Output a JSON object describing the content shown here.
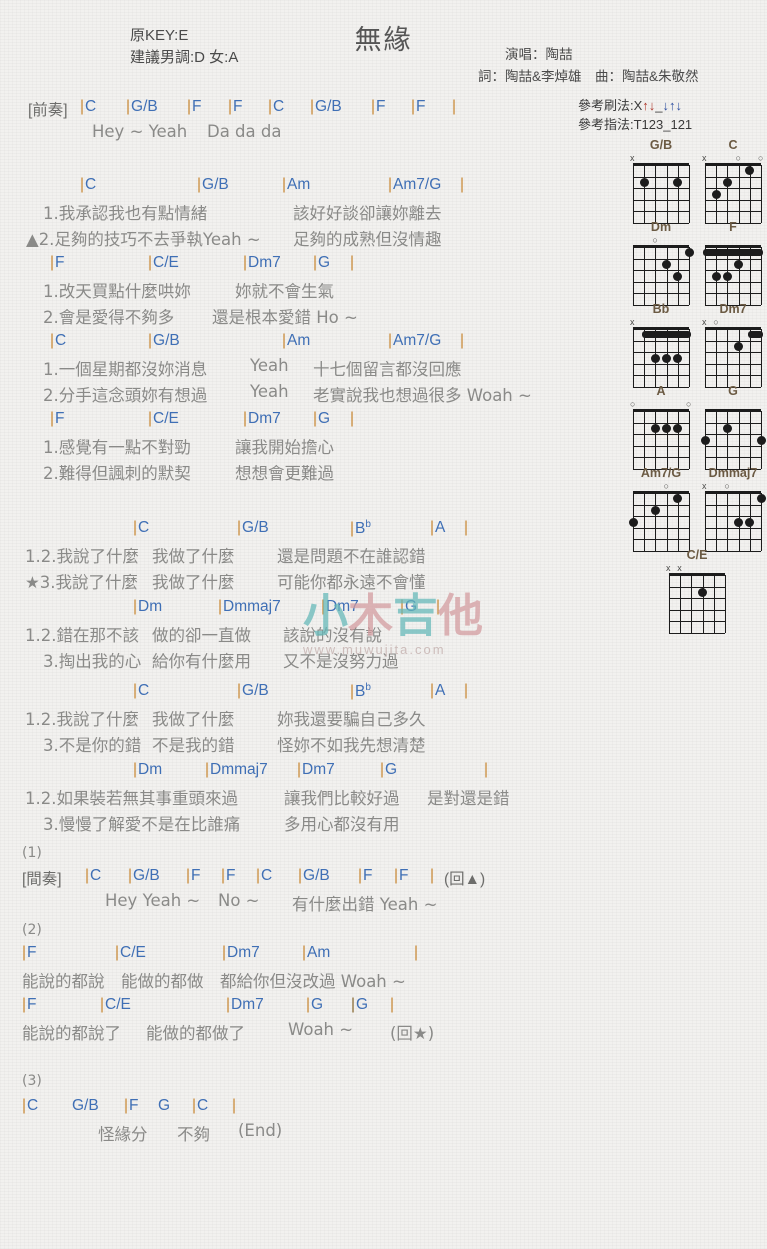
{
  "header": {
    "orig_key": "原KEY:E",
    "suggest_key": "建議男調:D 女:A",
    "title": "無緣",
    "singer": "演唱：陶喆",
    "writers": "詞：陶喆&李焯雄　曲：陶喆&朱敬然",
    "strum_label": "參考刷法:X",
    "strum_pattern_1": "↑↓",
    "strum_pattern_sep": "_",
    "strum_pattern_2": "↓↑↓",
    "fingerstyle": "參考指法:T123_121"
  },
  "sections": [
    {
      "name": "intro",
      "label": "[前奏]",
      "chords": [
        "C",
        "G/B",
        "F",
        "F",
        "C",
        "G/B",
        "F",
        "F"
      ],
      "lyrics": [
        "Hey ~ Yeah",
        "Da da da"
      ]
    },
    {
      "name": "verse1a",
      "chords": [
        "C",
        "G/B",
        "Am",
        "Am7/G"
      ],
      "line1": "1.我承認我也有點情緒",
      "line1b": "該好好談卻讓妳離去",
      "line2": "▲2.足夠的技巧不去爭執Yeah ~",
      "line2b": "足夠的成熟但沒情趣"
    },
    {
      "name": "verse1b",
      "chords": [
        "F",
        "C/E",
        "Dm7",
        "G"
      ],
      "line1": "1.改天買點什麼哄妳",
      "line1b": "妳就不會生氣",
      "line2": "2.會是愛得不夠多",
      "line2b": "還是根本愛錯 Ho ~"
    },
    {
      "name": "verse2a",
      "chords": [
        "C",
        "G/B",
        "Am",
        "Am7/G"
      ],
      "line1": "1.一個星期都沒妳消息",
      "line1mid": "Yeah",
      "line1b": "十七個留言都沒回應",
      "line2": "2.分手這念頭妳有想過",
      "line2mid": "Yeah",
      "line2b": "老實說我也想過很多 Woah ~"
    },
    {
      "name": "verse2b",
      "chords": [
        "F",
        "C/E",
        "Dm7",
        "G"
      ],
      "line1": "1.感覺有一點不對勁",
      "line1b": "讓我開始擔心",
      "line2": "2.難得但諷刺的默契",
      "line2b": "想想會更難過"
    },
    {
      "name": "chorus1a",
      "chords": [
        "C",
        "G/B",
        "Bb",
        "A"
      ],
      "line1": "1.2.我說了什麼",
      "line1m": "我做了什麼",
      "line1b": "還是問題不在誰認錯",
      "line2": "★3.我說了什麼",
      "line2m": "我做了什麼",
      "line2b": "可能你都永遠不會懂"
    },
    {
      "name": "chorus1b",
      "chords": [
        "Dm",
        "Dmmaj7",
        "Dm7",
        "G"
      ],
      "line1": "1.2.錯在那不該",
      "line1m": "做的卻一直做",
      "line1b": "該說的沒有說",
      "line2": "3.掏出我的心",
      "line2m": "給你有什麼用",
      "line2b": "又不是沒努力過"
    },
    {
      "name": "chorus2a",
      "chords": [
        "C",
        "G/B",
        "Bb",
        "A"
      ],
      "line1": "1.2.我說了什麼",
      "line1m": "我做了什麼",
      "line1b": "妳我還要騙自己多久",
      "line2": "3.不是你的錯",
      "line2m": "不是我的錯",
      "line2b": "怪妳不如我先想清楚"
    },
    {
      "name": "chorus2b",
      "chords": [
        "Dm",
        "Dmmaj7",
        "Dm7",
        "G"
      ],
      "line1": "1.2.如果裝若無其事重頭來過",
      "line1m": "讓我們比較好過",
      "line1b": "是對還是錯",
      "line2": "3.慢慢了解愛不是在比誰痛",
      "line2m": "多用心都沒有用"
    },
    {
      "name": "interlude",
      "num": "(1)",
      "label": "[間奏]",
      "chords": [
        "C",
        "G/B",
        "F",
        "F",
        "C",
        "G/B",
        "F",
        "F"
      ],
      "repeat": "(回▲)",
      "lyric1": "Hey Yeah ~",
      "lyric2": "No ~",
      "lyric3": "有什麼出錯 Yeah ~"
    },
    {
      "name": "bridge",
      "num": "(2)",
      "chords_a": [
        "F",
        "C/E",
        "Dm7",
        "Am"
      ],
      "lyric_a": "能說的都說　能做的都做　都給你但沒改過 Woah ~",
      "chords_b": [
        "F",
        "C/E",
        "Dm7",
        "G",
        "G"
      ],
      "lyric_b1": "能說的都說了",
      "lyric_b2": "能做的都做了",
      "lyric_b3": "Woah ~",
      "repeat": "(回★)"
    },
    {
      "name": "ending",
      "num": "(3)",
      "chords": [
        "C",
        "G/B",
        "F",
        "G",
        "C"
      ],
      "lyric1": "怪緣分",
      "lyric2": "不夠",
      "lyric3": "(End)"
    }
  ],
  "chord_diagrams": [
    {
      "name": "G/B",
      "marks": [
        {
          "s": 0,
          "t": "x"
        }
      ],
      "dots": [
        {
          "s": 1,
          "f": 2
        },
        {
          "s": 4,
          "f": 2
        }
      ],
      "barre": null
    },
    {
      "name": "C",
      "marks": [
        {
          "s": 0,
          "t": "x"
        },
        {
          "s": 3,
          "t": "o"
        },
        {
          "s": 5,
          "t": "o"
        }
      ],
      "dots": [
        {
          "s": 1,
          "f": 3
        },
        {
          "s": 2,
          "f": 2
        },
        {
          "s": 4,
          "f": 1
        }
      ],
      "barre": null
    },
    {
      "name": "Dm",
      "marks": [
        {
          "s": 2,
          "t": "o"
        }
      ],
      "dots": [
        {
          "s": 3,
          "f": 2
        },
        {
          "s": 4,
          "f": 3
        },
        {
          "s": 5,
          "f": 1
        }
      ],
      "barre": null
    },
    {
      "name": "F",
      "marks": [],
      "dots": [
        {
          "s": 1,
          "f": 3
        },
        {
          "s": 2,
          "f": 3
        },
        {
          "s": 3,
          "f": 2
        }
      ],
      "barre": {
        "f": 1,
        "from": 0,
        "to": 5
      }
    },
    {
      "name": "Bb",
      "marks": [
        {
          "s": 0,
          "t": "x"
        }
      ],
      "dots": [
        {
          "s": 2,
          "f": 3
        },
        {
          "s": 3,
          "f": 3
        },
        {
          "s": 4,
          "f": 3
        }
      ],
      "barre": {
        "f": 1,
        "from": 1,
        "to": 5
      }
    },
    {
      "name": "Dm7",
      "marks": [
        {
          "s": 0,
          "t": "x"
        },
        {
          "s": 1,
          "t": "o"
        }
      ],
      "dots": [
        {
          "s": 3,
          "f": 2
        }
      ],
      "barre": {
        "f": 1,
        "from": 4,
        "to": 5
      }
    },
    {
      "name": "A",
      "marks": [
        {
          "s": 0,
          "t": "o"
        },
        {
          "s": 5,
          "t": "o"
        }
      ],
      "dots": [
        {
          "s": 2,
          "f": 2
        },
        {
          "s": 3,
          "f": 2
        },
        {
          "s": 4,
          "f": 2
        }
      ],
      "barre": null
    },
    {
      "name": "G",
      "marks": [],
      "dots": [
        {
          "s": 0,
          "f": 3
        },
        {
          "s": 2,
          "f": 2
        },
        {
          "s": 5,
          "f": 3
        }
      ],
      "barre": null
    },
    {
      "name": "Am7/G",
      "marks": [
        {
          "s": 3,
          "t": "o"
        }
      ],
      "dots": [
        {
          "s": 0,
          "f": 3
        },
        {
          "s": 2,
          "f": 2
        },
        {
          "s": 4,
          "f": 1
        }
      ],
      "barre": null
    },
    {
      "name": "Dmmaj7",
      "marks": [
        {
          "s": 0,
          "t": "x"
        },
        {
          "s": 2,
          "t": "o"
        }
      ],
      "dots": [
        {
          "s": 3,
          "f": 3
        },
        {
          "s": 4,
          "f": 3
        },
        {
          "s": 5,
          "f": 1
        }
      ],
      "barre": null
    },
    {
      "name": "C/E",
      "marks": [
        {
          "s": 0,
          "t": "x"
        },
        {
          "s": 1,
          "t": "x"
        }
      ],
      "dots": [
        {
          "s": 3,
          "f": 2
        }
      ],
      "barre": null
    }
  ],
  "watermark": {
    "text_1": "小",
    "text_2": "木",
    "text_3": "吉",
    "text_4": "他",
    "url": "www.muwujita.com"
  },
  "colors": {
    "chord": "#3f6fb5",
    "barline": "#c98a37",
    "lyric": "#8a8a88",
    "diagram_name": "#6b5a43",
    "watermark_teal": "#63b8b8",
    "watermark_pink": "#d39a9e"
  }
}
